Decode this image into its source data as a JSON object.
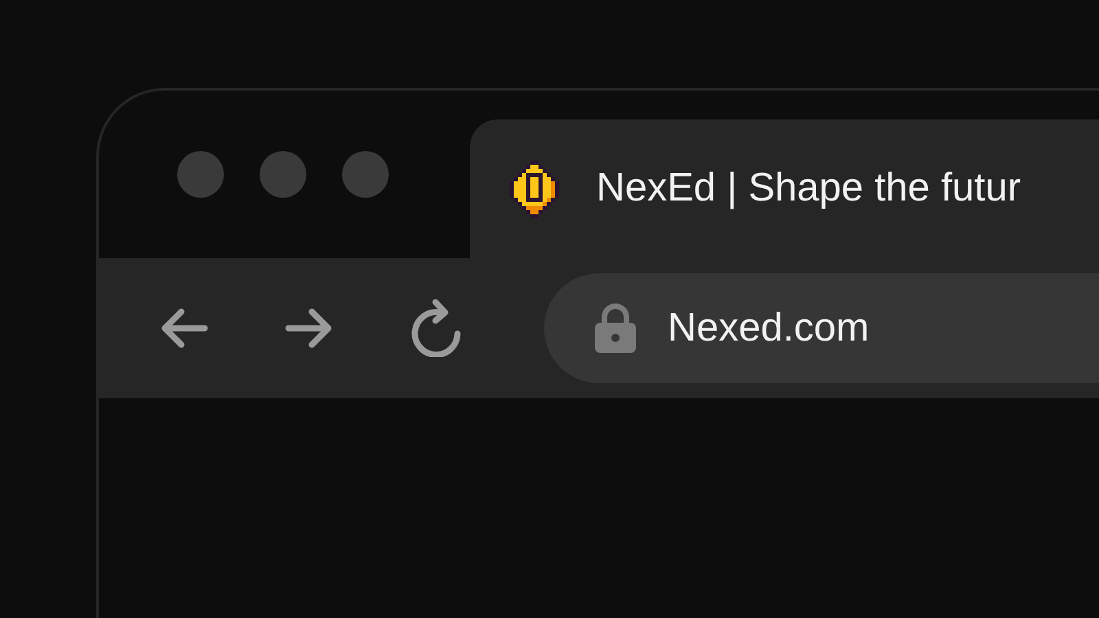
{
  "tab": {
    "title": "NexEd | Shape the futur"
  },
  "address_bar": {
    "value": "Nexed.com"
  }
}
